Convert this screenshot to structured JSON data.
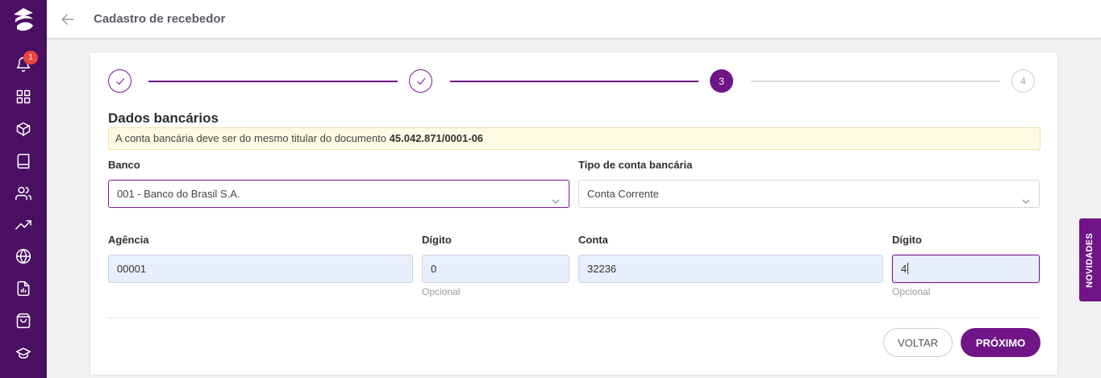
{
  "sidebar": {
    "logo_icon": "brand-logo-icon",
    "notification_count": "1",
    "items": [
      {
        "icon": "bell-icon"
      },
      {
        "icon": "grid-icon"
      },
      {
        "icon": "box-icon"
      },
      {
        "icon": "book-icon"
      },
      {
        "icon": "users-icon"
      },
      {
        "icon": "trending-up-icon"
      },
      {
        "icon": "globe-icon"
      },
      {
        "icon": "file-chart-icon"
      },
      {
        "icon": "shopping-bag-icon"
      },
      {
        "icon": "graduation-cap-icon"
      }
    ]
  },
  "header": {
    "title": "Cadastro de recebedor"
  },
  "stepper": {
    "current_step": "3",
    "next_step": "4"
  },
  "form": {
    "section_title": "Dados bancários",
    "alert_text": "A conta bancária deve ser do mesmo titular do documento",
    "alert_document": "45.042.871/0001-06",
    "bank_label": "Banco",
    "bank_value": "001 - Banco do Brasil S.A.",
    "account_type_label": "Tipo de conta bancária",
    "account_type_value": "Conta Corrente",
    "agency_label": "Agência",
    "agency_value": "00001",
    "agency_digit_label": "Dígito",
    "agency_digit_value": "0",
    "agency_digit_hint": "Opcional",
    "account_label": "Conta",
    "account_value": "32236",
    "account_digit_label": "Dígito",
    "account_digit_value": "4",
    "account_digit_hint": "Opcional"
  },
  "actions": {
    "back_label": "VOLTAR",
    "next_label": "PRÓXIMO"
  },
  "side_tab": {
    "label": "NOVIDADES"
  },
  "colors": {
    "primary": "#6f1587",
    "sidebar": "#4a0f63",
    "alert_bg": "#fffae3",
    "input_bg": "#e8effc"
  }
}
